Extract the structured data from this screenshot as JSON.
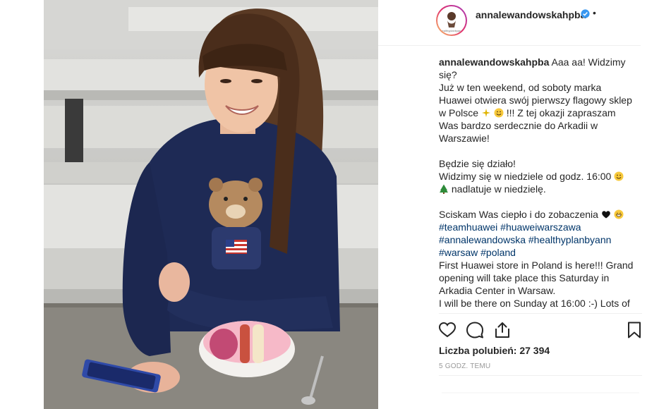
{
  "post": {
    "username": "annalewandowskahpba",
    "avatar_text": "healthy plan by ann",
    "verified_icon": "verified-badge-icon",
    "more_icon": "dot-icon",
    "caption": {
      "author": "annalewandowskahpba",
      "lines": {
        "l1": "Aaa aa! Widzimy się?",
        "l2a": "Już w ten weekend, od soboty marka Huawei otwiera swój pierwszy flagowy sklep w Polsce",
        "l2b": "!!! Z tej okazji zapraszam Was bardzo serdecznie do Arkadii w Warszawie!",
        "l3": "Będzie się działo!",
        "l4a": "Widzimy się w niedziele od godz. 16:00",
        "l4b": "nadlatuje w niedzielę.",
        "l5": "Sciskam Was ciepło i do zobaczenia",
        "h1": "#teamhuawei",
        "h2": "#huaweiwarszawa",
        "h3": "#annalewandowska",
        "h4": "#healthyplanbyann",
        "h5": "#warsaw",
        "h6": "#poland",
        "en1": "First Huawei store in Poland is here!!! Grand opening will take place this Saturday in Arkadia Center in Warsaw.",
        "en2": "I will be there on Sunday at 16:00 :-) Lots of"
      }
    },
    "actions": {
      "like_icon": "heart-icon",
      "comment_icon": "comment-icon",
      "share_icon": "share-icon",
      "save_icon": "bookmark-icon"
    },
    "likes_label": "Liczba polubień: 27 394",
    "time_label": "5 GODZ. TEMU"
  }
}
